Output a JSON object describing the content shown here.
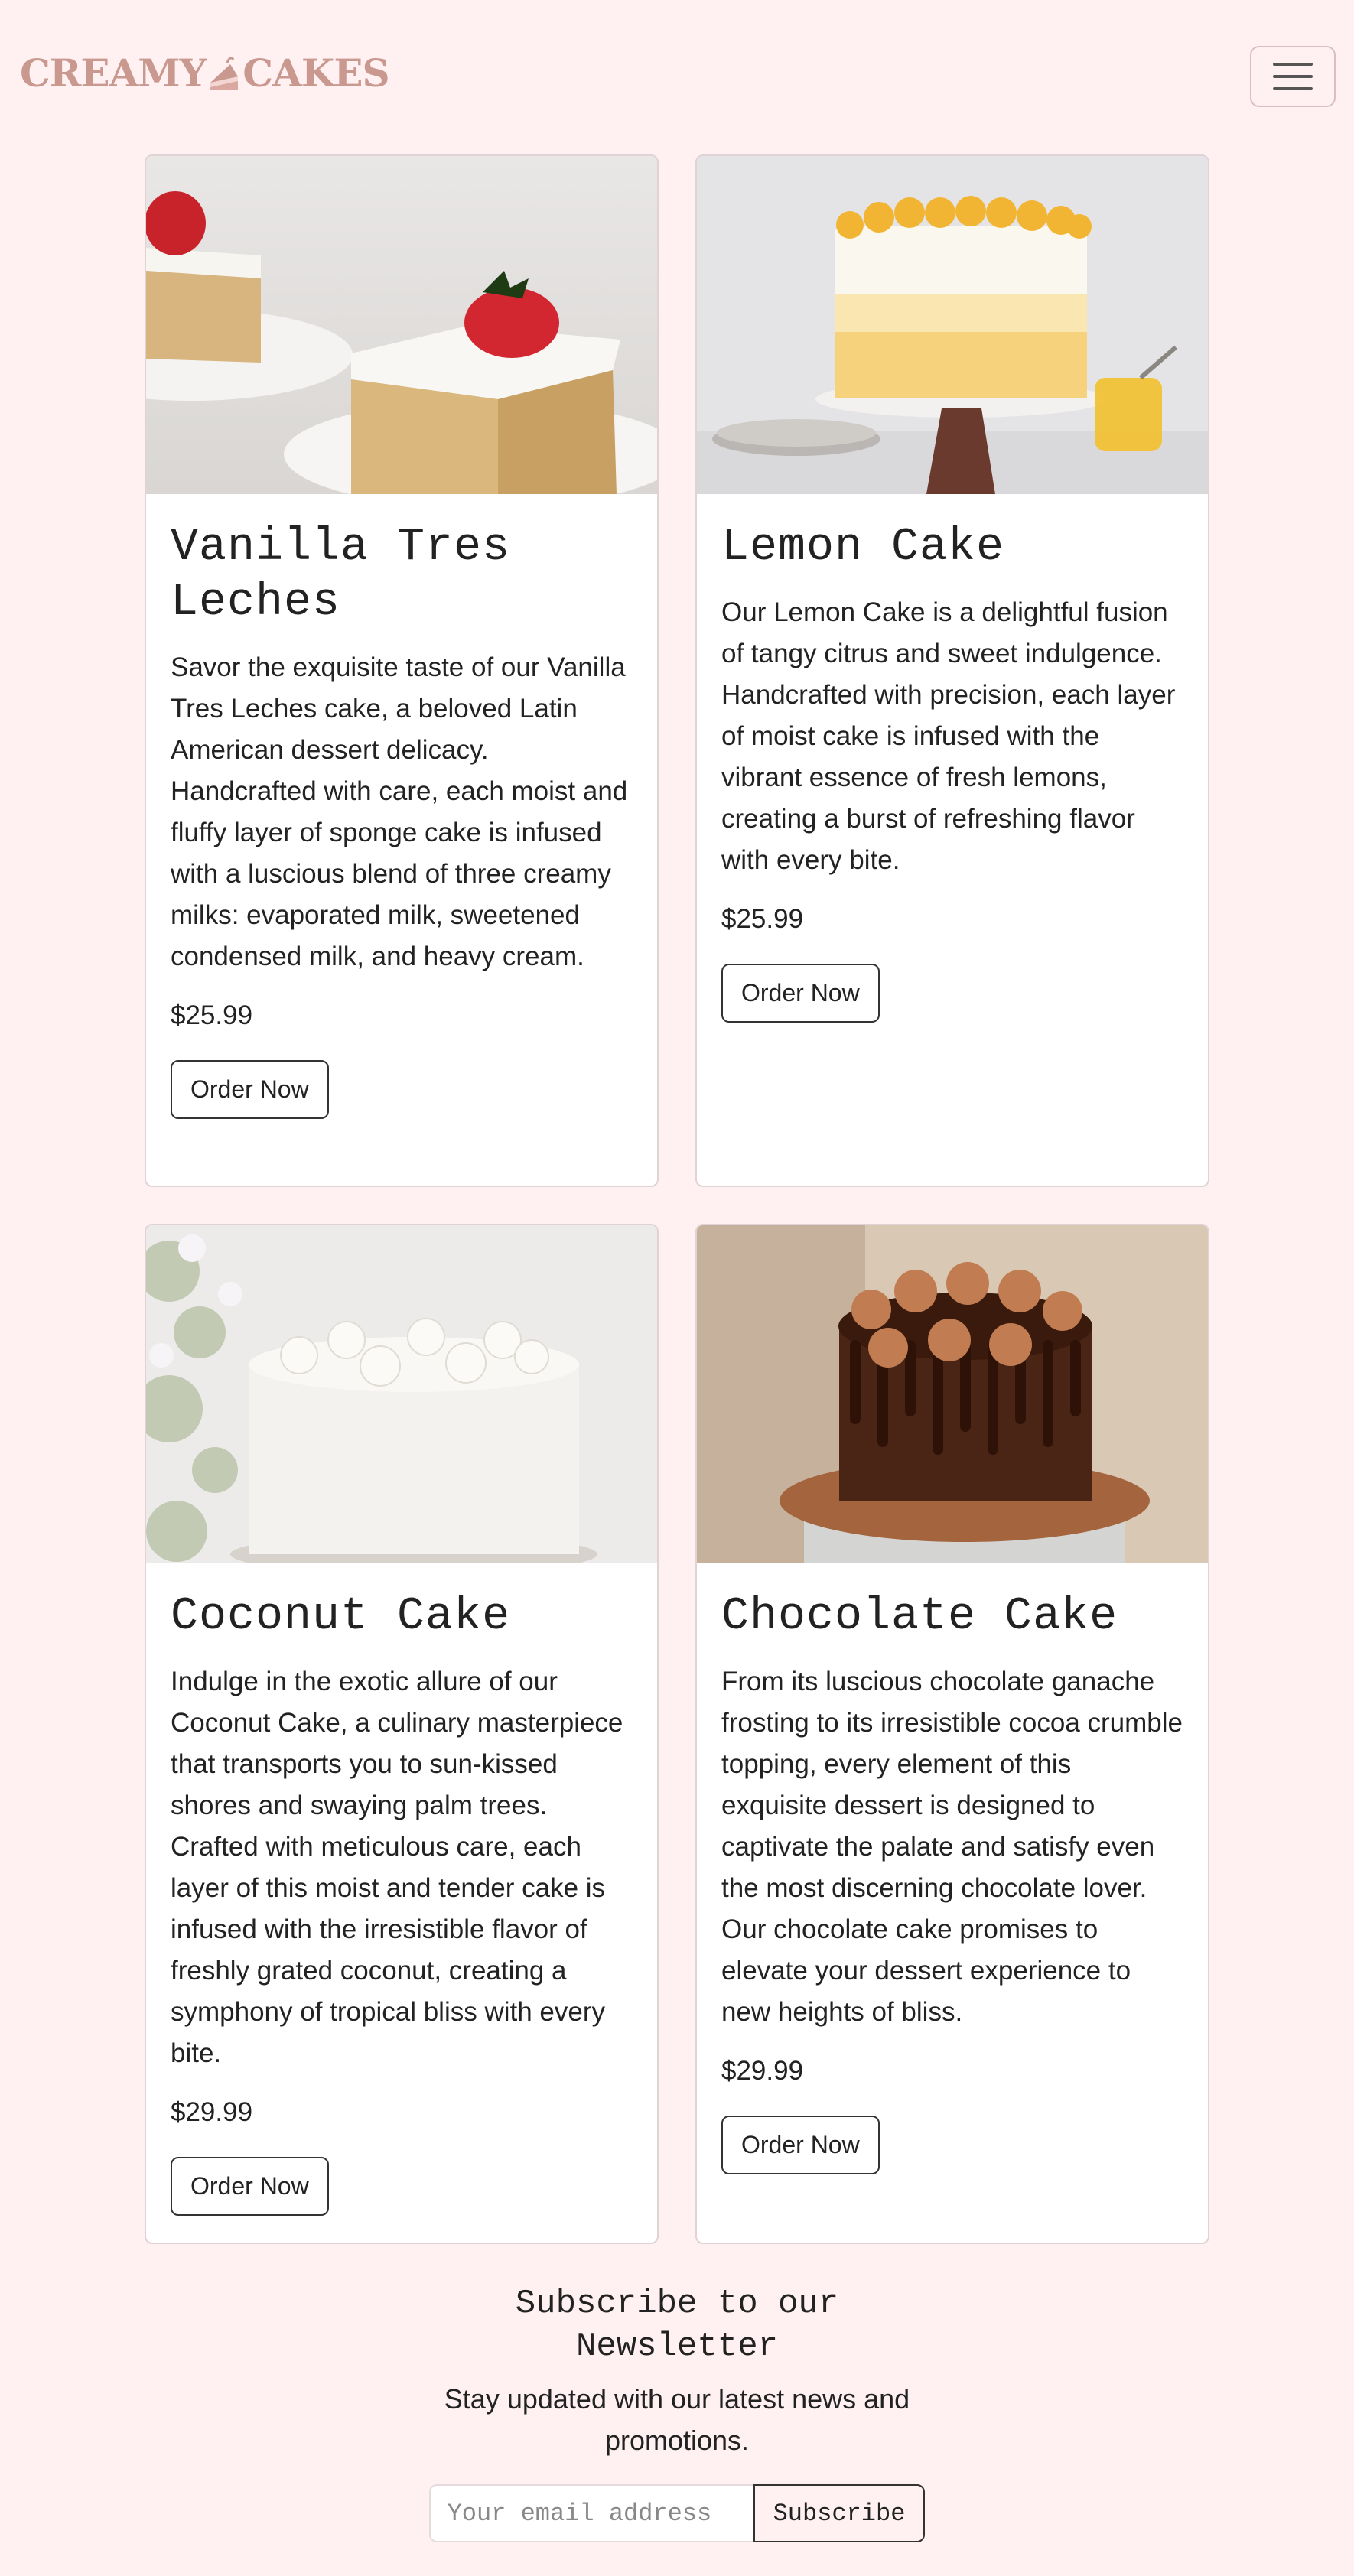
{
  "brand": {
    "part1": "CREAMY",
    "part2": "CAKES",
    "accent": "#c9988f"
  },
  "nav": {
    "toggle_icon": "hamburger-icon"
  },
  "cards": [
    {
      "title": "Vanilla Tres Leches",
      "description": "Savor the exquisite taste of our Vanilla Tres Leches cake, a beloved Latin American dessert delicacy. Handcrafted with care, each moist and fluffy layer of sponge cake is infused with a luscious blend of three creamy milks: evaporated milk, sweetened condensed milk, and heavy cream.",
      "price": "$25.99",
      "button": "Order Now",
      "image": "tres-leches-slice-with-strawberry"
    },
    {
      "title": "Lemon Cake",
      "description": "Our Lemon Cake is a delightful fusion of tangy citrus and sweet indulgence. Handcrafted with precision, each layer of moist cake is infused with the vibrant essence of fresh lemons, creating a burst of refreshing flavor with every bite.",
      "price": "$25.99",
      "button": "Order Now",
      "image": "lemon-cake-on-stand"
    },
    {
      "title": "Coconut Cake",
      "description": "Indulge in the exotic allure of our Coconut Cake, a culinary masterpiece that transports you to sun-kissed shores and swaying palm trees. Crafted with meticulous care, each layer of this moist and tender cake is infused with the irresistible flavor of freshly grated coconut, creating a symphony of tropical bliss with every bite.",
      "price": "$29.99",
      "button": "Order Now",
      "image": "white-coconut-cake"
    },
    {
      "title": "Chocolate Cake",
      "description": "From its luscious chocolate ganache frosting to its irresistible cocoa crumble topping, every element of this exquisite dessert is designed to captivate the palate and satisfy even the most discerning chocolate lover. Our chocolate cake promises to elevate your dessert experience to new heights of bliss.",
      "price": "$29.99",
      "button": "Order Now",
      "image": "chocolate-drip-cake"
    }
  ],
  "newsletter": {
    "title": "Subscribe to our Newsletter",
    "text": "Stay updated with our latest news and promotions.",
    "placeholder": "Your email address",
    "button": "Subscribe"
  }
}
